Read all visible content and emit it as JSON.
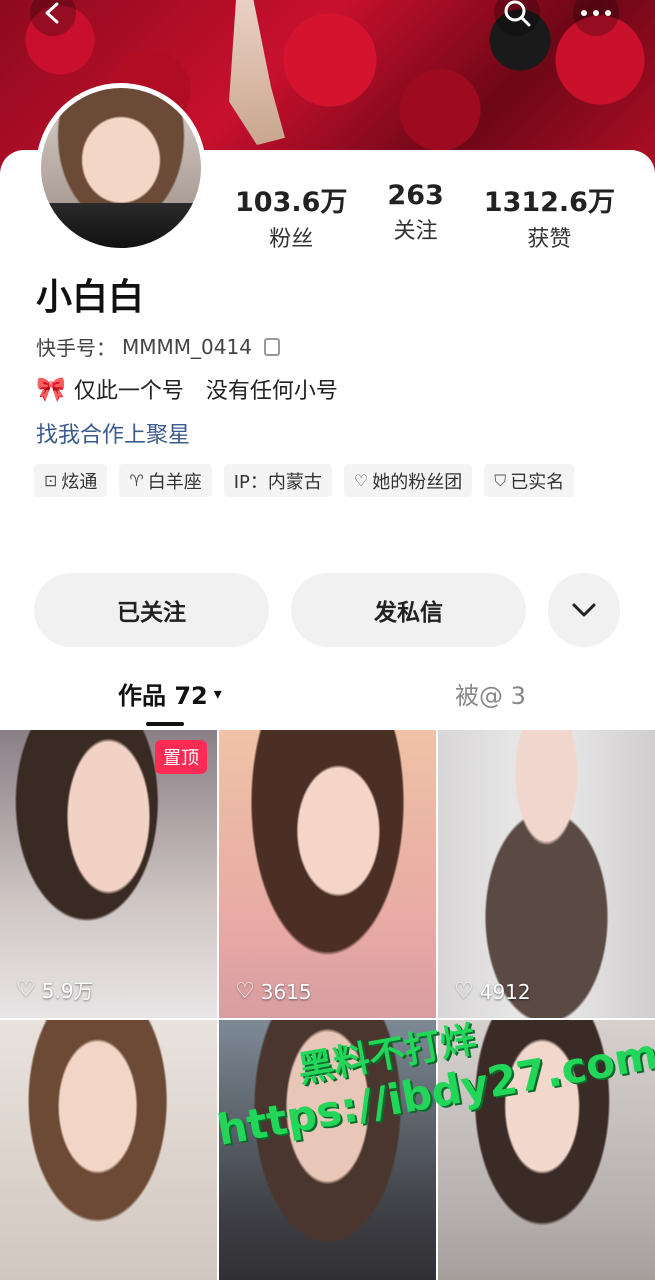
{
  "header": {
    "back_icon": "chevron-left-icon",
    "search_icon": "search-icon",
    "more_icon": "more-icon"
  },
  "profile": {
    "stats": [
      {
        "value": "103.6万",
        "label": "粉丝"
      },
      {
        "value": "263",
        "label": "关注"
      },
      {
        "value": "1312.6万",
        "label": "获赞"
      }
    ],
    "name": "小白白",
    "kuaishou_id_label": "快手号：",
    "kuaishou_id": "MMMM_0414",
    "bio_emoji": "🎀",
    "bio": "仅此一个号　没有任何小号",
    "link": "找我合作上聚星",
    "tags": [
      {
        "icon": "promote-icon",
        "glyph": "⊡",
        "label": "炫通"
      },
      {
        "icon": "zodiac-icon",
        "glyph": "♈",
        "label": "白羊座"
      },
      {
        "icon": "",
        "glyph": "",
        "label": "IP：内蒙古"
      },
      {
        "icon": "fan-club-icon",
        "glyph": "♡",
        "label": "她的粉丝团"
      },
      {
        "icon": "verified-icon",
        "glyph": "⛉",
        "label": "已实名"
      }
    ]
  },
  "actions": {
    "follow_label": "已关注",
    "message_label": "发私信",
    "more_glyph": "⌄"
  },
  "tabs": {
    "works_label": "作品 72",
    "works_caret": "▾",
    "mentioned_label": "被@ 3"
  },
  "grid": {
    "pinned_label": "置顶",
    "items": [
      {
        "likes": "5.9万"
      },
      {
        "likes": "3615"
      },
      {
        "likes": "4912"
      },
      {
        "likes": ""
      },
      {
        "likes": ""
      },
      {
        "likes": ""
      }
    ]
  },
  "watermark": {
    "line1": "黑料不打烊",
    "line2": "https://ibdy27.com"
  }
}
